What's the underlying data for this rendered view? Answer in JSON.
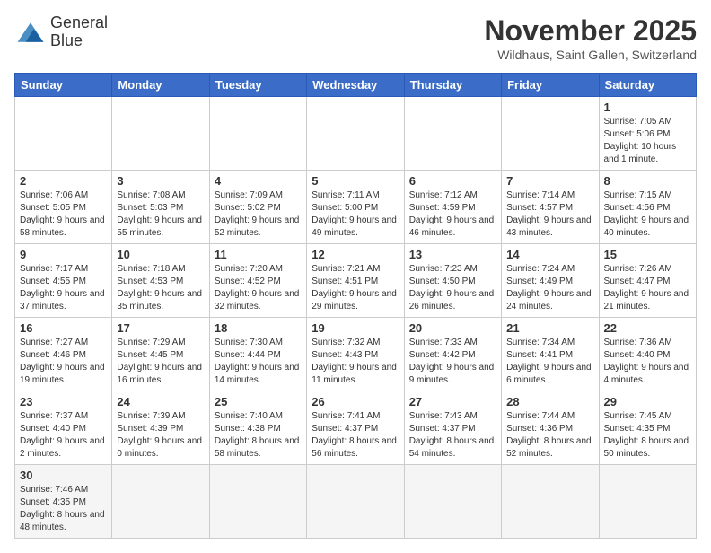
{
  "header": {
    "logo_line1": "General",
    "logo_line2": "Blue",
    "month": "November 2025",
    "location": "Wildhaus, Saint Gallen, Switzerland"
  },
  "weekdays": [
    "Sunday",
    "Monday",
    "Tuesday",
    "Wednesday",
    "Thursday",
    "Friday",
    "Saturday"
  ],
  "weeks": [
    [
      {
        "day": "",
        "info": ""
      },
      {
        "day": "",
        "info": ""
      },
      {
        "day": "",
        "info": ""
      },
      {
        "day": "",
        "info": ""
      },
      {
        "day": "",
        "info": ""
      },
      {
        "day": "",
        "info": ""
      },
      {
        "day": "1",
        "info": "Sunrise: 7:05 AM\nSunset: 5:06 PM\nDaylight: 10 hours and 1 minute."
      }
    ],
    [
      {
        "day": "2",
        "info": "Sunrise: 7:06 AM\nSunset: 5:05 PM\nDaylight: 9 hours and 58 minutes."
      },
      {
        "day": "3",
        "info": "Sunrise: 7:08 AM\nSunset: 5:03 PM\nDaylight: 9 hours and 55 minutes."
      },
      {
        "day": "4",
        "info": "Sunrise: 7:09 AM\nSunset: 5:02 PM\nDaylight: 9 hours and 52 minutes."
      },
      {
        "day": "5",
        "info": "Sunrise: 7:11 AM\nSunset: 5:00 PM\nDaylight: 9 hours and 49 minutes."
      },
      {
        "day": "6",
        "info": "Sunrise: 7:12 AM\nSunset: 4:59 PM\nDaylight: 9 hours and 46 minutes."
      },
      {
        "day": "7",
        "info": "Sunrise: 7:14 AM\nSunset: 4:57 PM\nDaylight: 9 hours and 43 minutes."
      },
      {
        "day": "8",
        "info": "Sunrise: 7:15 AM\nSunset: 4:56 PM\nDaylight: 9 hours and 40 minutes."
      }
    ],
    [
      {
        "day": "9",
        "info": "Sunrise: 7:17 AM\nSunset: 4:55 PM\nDaylight: 9 hours and 37 minutes."
      },
      {
        "day": "10",
        "info": "Sunrise: 7:18 AM\nSunset: 4:53 PM\nDaylight: 9 hours and 35 minutes."
      },
      {
        "day": "11",
        "info": "Sunrise: 7:20 AM\nSunset: 4:52 PM\nDaylight: 9 hours and 32 minutes."
      },
      {
        "day": "12",
        "info": "Sunrise: 7:21 AM\nSunset: 4:51 PM\nDaylight: 9 hours and 29 minutes."
      },
      {
        "day": "13",
        "info": "Sunrise: 7:23 AM\nSunset: 4:50 PM\nDaylight: 9 hours and 26 minutes."
      },
      {
        "day": "14",
        "info": "Sunrise: 7:24 AM\nSunset: 4:49 PM\nDaylight: 9 hours and 24 minutes."
      },
      {
        "day": "15",
        "info": "Sunrise: 7:26 AM\nSunset: 4:47 PM\nDaylight: 9 hours and 21 minutes."
      }
    ],
    [
      {
        "day": "16",
        "info": "Sunrise: 7:27 AM\nSunset: 4:46 PM\nDaylight: 9 hours and 19 minutes."
      },
      {
        "day": "17",
        "info": "Sunrise: 7:29 AM\nSunset: 4:45 PM\nDaylight: 9 hours and 16 minutes."
      },
      {
        "day": "18",
        "info": "Sunrise: 7:30 AM\nSunset: 4:44 PM\nDaylight: 9 hours and 14 minutes."
      },
      {
        "day": "19",
        "info": "Sunrise: 7:32 AM\nSunset: 4:43 PM\nDaylight: 9 hours and 11 minutes."
      },
      {
        "day": "20",
        "info": "Sunrise: 7:33 AM\nSunset: 4:42 PM\nDaylight: 9 hours and 9 minutes."
      },
      {
        "day": "21",
        "info": "Sunrise: 7:34 AM\nSunset: 4:41 PM\nDaylight: 9 hours and 6 minutes."
      },
      {
        "day": "22",
        "info": "Sunrise: 7:36 AM\nSunset: 4:40 PM\nDaylight: 9 hours and 4 minutes."
      }
    ],
    [
      {
        "day": "23",
        "info": "Sunrise: 7:37 AM\nSunset: 4:40 PM\nDaylight: 9 hours and 2 minutes."
      },
      {
        "day": "24",
        "info": "Sunrise: 7:39 AM\nSunset: 4:39 PM\nDaylight: 9 hours and 0 minutes."
      },
      {
        "day": "25",
        "info": "Sunrise: 7:40 AM\nSunset: 4:38 PM\nDaylight: 8 hours and 58 minutes."
      },
      {
        "day": "26",
        "info": "Sunrise: 7:41 AM\nSunset: 4:37 PM\nDaylight: 8 hours and 56 minutes."
      },
      {
        "day": "27",
        "info": "Sunrise: 7:43 AM\nSunset: 4:37 PM\nDaylight: 8 hours and 54 minutes."
      },
      {
        "day": "28",
        "info": "Sunrise: 7:44 AM\nSunset: 4:36 PM\nDaylight: 8 hours and 52 minutes."
      },
      {
        "day": "29",
        "info": "Sunrise: 7:45 AM\nSunset: 4:35 PM\nDaylight: 8 hours and 50 minutes."
      }
    ],
    [
      {
        "day": "30",
        "info": "Sunrise: 7:46 AM\nSunset: 4:35 PM\nDaylight: 8 hours and 48 minutes."
      },
      {
        "day": "",
        "info": ""
      },
      {
        "day": "",
        "info": ""
      },
      {
        "day": "",
        "info": ""
      },
      {
        "day": "",
        "info": ""
      },
      {
        "day": "",
        "info": ""
      },
      {
        "day": "",
        "info": ""
      }
    ]
  ]
}
